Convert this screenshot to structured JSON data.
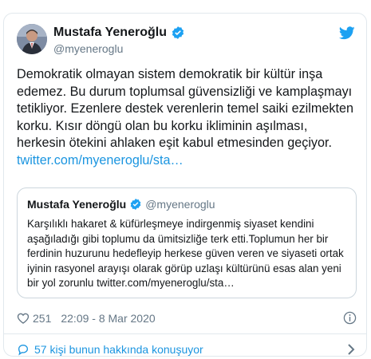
{
  "tweet": {
    "author": {
      "name": "Mustafa Yeneroğlu",
      "handle": "@myeneroglu",
      "verified": true
    },
    "text": "Demokratik olmayan sistem demokratik bir kültür inşa edemez. Bu durum toplumsal güvensizliği ve kamplaşmayı tetikliyor. Ezenlere destek verenlerin temel saiki ezilmekten korku. Kısır döngü olan bu korku ikliminin aşılması, herkesin ötekini ahlaken eşit kabul etmesinden geçiyor.",
    "link": "twitter.com/myeneroglu/sta…",
    "quoted": {
      "name": "Mustafa Yeneroğlu",
      "handle": "@myeneroglu",
      "text": "Karşılıklı hakaret & küfürleşmeye indirgenmiş siyaset kendini aşağıladığı gibi toplumu da ümitsizliğe terk etti.Toplumun her bir ferdinin huzurunu hedefleyip herkese güven veren ve siyaseti ortak iyinin rasyonel arayışı olarak görüp uzlaşı kültürünü esas alan yeni bir yol zorunlu twitter.com/myeneroglu/sta…"
    },
    "likes": "251",
    "timestamp": "22:09 - 8 Mar 2020",
    "conversation_label": "57 kişi bunun hakkında konuşuyor"
  },
  "icons": {
    "brand": "twitter-bird-icon",
    "verified": "verified-badge-icon",
    "like": "heart-icon",
    "info": "info-icon",
    "reply": "reply-bubble-icon",
    "chevron": "chevron-right-icon"
  },
  "colors": {
    "brand_blue": "#1da1f2",
    "link_blue": "#1b95e0",
    "text_primary": "#14171a",
    "text_secondary": "#657786",
    "border": "#e1e8ed"
  }
}
